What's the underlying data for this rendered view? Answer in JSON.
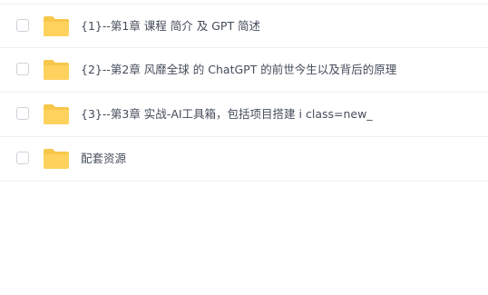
{
  "file_list": {
    "items": [
      {
        "name": "{1}--第1章 课程 简介 及 GPT 简述",
        "icon": "folder-icon",
        "checked": false
      },
      {
        "name": "{2}--第2章 风靡全球 的 ChatGPT 的前世今生以及背后的原理",
        "icon": "folder-icon",
        "checked": false
      },
      {
        "name": "{3}--第3章 实战-AI工具箱，包括项目搭建 i class=new_",
        "icon": "folder-icon",
        "checked": false
      },
      {
        "name": "配套资源",
        "icon": "folder-icon",
        "checked": false
      }
    ],
    "folder_color": "#FFD25E",
    "folder_tab_color": "#F7C74A"
  }
}
